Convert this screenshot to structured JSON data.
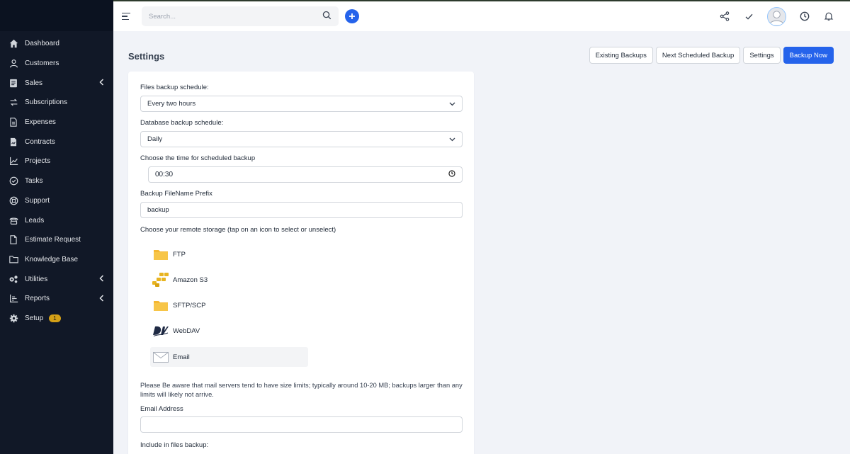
{
  "sidebar": {
    "items": [
      {
        "label": "Dashboard",
        "icon": "home-icon"
      },
      {
        "label": "Customers",
        "icon": "user-icon"
      },
      {
        "label": "Sales",
        "icon": "receipt-icon",
        "has_children": true
      },
      {
        "label": "Subscriptions",
        "icon": "refresh-icon"
      },
      {
        "label": "Expenses",
        "icon": "file-icon"
      },
      {
        "label": "Contracts",
        "icon": "contract-icon"
      },
      {
        "label": "Projects",
        "icon": "chart-icon"
      },
      {
        "label": "Tasks",
        "icon": "check-circle-icon"
      },
      {
        "label": "Support",
        "icon": "lifebuoy-icon"
      },
      {
        "label": "Leads",
        "icon": "phone-icon"
      },
      {
        "label": "Estimate Request",
        "icon": "document-icon"
      },
      {
        "label": "Knowledge Base",
        "icon": "folder-icon"
      },
      {
        "label": "Utilities",
        "icon": "gears-icon",
        "has_children": true
      },
      {
        "label": "Reports",
        "icon": "bar-chart-icon",
        "has_children": true
      },
      {
        "label": "Setup",
        "icon": "gear-icon",
        "badge": "1"
      }
    ]
  },
  "topbar": {
    "search_placeholder": "Search..."
  },
  "page": {
    "title": "Settings",
    "actions": {
      "existing": "Existing Backups",
      "next": "Next Scheduled Backup",
      "settings": "Settings",
      "backup_now": "Backup Now"
    }
  },
  "form": {
    "files_schedule": {
      "label": "Files backup schedule:",
      "value": "Every two hours"
    },
    "db_schedule": {
      "label": "Database backup schedule:",
      "value": "Daily"
    },
    "time": {
      "label": "Choose the time for scheduled backup",
      "value": "00:30"
    },
    "prefix": {
      "label": "Backup FileName Prefix",
      "value": "backup"
    },
    "storage": {
      "label": "Choose your remote storage (tap on an icon to select or unselect)",
      "options": [
        {
          "label": "FTP",
          "icon": "folder-icon"
        },
        {
          "label": "Amazon S3",
          "icon": "amazon-s3-icon"
        },
        {
          "label": "SFTP/SCP",
          "icon": "folder-icon"
        },
        {
          "label": "WebDAV",
          "icon": "webdav-icon"
        },
        {
          "label": "Email",
          "icon": "email-icon",
          "selected": true
        }
      ]
    },
    "email_note": "Please Be aware that mail servers tend to have size limits; typically around 10-20 MB; backups larger than any limits will likely not arrive.",
    "email_address": {
      "label": "Email Address",
      "value": ""
    },
    "include_label": "Include in files backup:"
  },
  "colors": {
    "sidebar_bg": "#111827",
    "primary": "#2563eb",
    "badge": "#d4a017",
    "page_bg": "#f1f3f8",
    "folder": "#f5b731"
  }
}
